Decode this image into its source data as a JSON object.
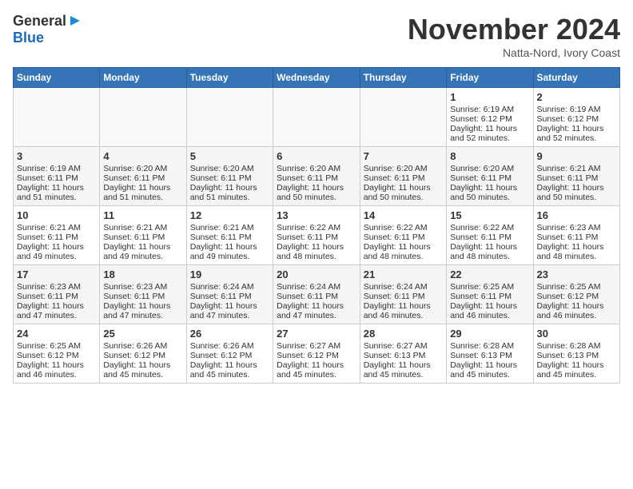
{
  "header": {
    "logo_general": "General",
    "logo_blue": "Blue",
    "month_title": "November 2024",
    "location": "Natta-Nord, Ivory Coast"
  },
  "days_of_week": [
    "Sunday",
    "Monday",
    "Tuesday",
    "Wednesday",
    "Thursday",
    "Friday",
    "Saturday"
  ],
  "weeks": [
    {
      "cells": [
        {
          "day": "",
          "sunrise": "",
          "sunset": "",
          "daylight": ""
        },
        {
          "day": "",
          "sunrise": "",
          "sunset": "",
          "daylight": ""
        },
        {
          "day": "",
          "sunrise": "",
          "sunset": "",
          "daylight": ""
        },
        {
          "day": "",
          "sunrise": "",
          "sunset": "",
          "daylight": ""
        },
        {
          "day": "",
          "sunrise": "",
          "sunset": "",
          "daylight": ""
        },
        {
          "day": "1",
          "sunrise": "Sunrise: 6:19 AM",
          "sunset": "Sunset: 6:12 PM",
          "daylight": "Daylight: 11 hours and 52 minutes."
        },
        {
          "day": "2",
          "sunrise": "Sunrise: 6:19 AM",
          "sunset": "Sunset: 6:12 PM",
          "daylight": "Daylight: 11 hours and 52 minutes."
        }
      ]
    },
    {
      "cells": [
        {
          "day": "3",
          "sunrise": "Sunrise: 6:19 AM",
          "sunset": "Sunset: 6:11 PM",
          "daylight": "Daylight: 11 hours and 51 minutes."
        },
        {
          "day": "4",
          "sunrise": "Sunrise: 6:20 AM",
          "sunset": "Sunset: 6:11 PM",
          "daylight": "Daylight: 11 hours and 51 minutes."
        },
        {
          "day": "5",
          "sunrise": "Sunrise: 6:20 AM",
          "sunset": "Sunset: 6:11 PM",
          "daylight": "Daylight: 11 hours and 51 minutes."
        },
        {
          "day": "6",
          "sunrise": "Sunrise: 6:20 AM",
          "sunset": "Sunset: 6:11 PM",
          "daylight": "Daylight: 11 hours and 50 minutes."
        },
        {
          "day": "7",
          "sunrise": "Sunrise: 6:20 AM",
          "sunset": "Sunset: 6:11 PM",
          "daylight": "Daylight: 11 hours and 50 minutes."
        },
        {
          "day": "8",
          "sunrise": "Sunrise: 6:20 AM",
          "sunset": "Sunset: 6:11 PM",
          "daylight": "Daylight: 11 hours and 50 minutes."
        },
        {
          "day": "9",
          "sunrise": "Sunrise: 6:21 AM",
          "sunset": "Sunset: 6:11 PM",
          "daylight": "Daylight: 11 hours and 50 minutes."
        }
      ]
    },
    {
      "cells": [
        {
          "day": "10",
          "sunrise": "Sunrise: 6:21 AM",
          "sunset": "Sunset: 6:11 PM",
          "daylight": "Daylight: 11 hours and 49 minutes."
        },
        {
          "day": "11",
          "sunrise": "Sunrise: 6:21 AM",
          "sunset": "Sunset: 6:11 PM",
          "daylight": "Daylight: 11 hours and 49 minutes."
        },
        {
          "day": "12",
          "sunrise": "Sunrise: 6:21 AM",
          "sunset": "Sunset: 6:11 PM",
          "daylight": "Daylight: 11 hours and 49 minutes."
        },
        {
          "day": "13",
          "sunrise": "Sunrise: 6:22 AM",
          "sunset": "Sunset: 6:11 PM",
          "daylight": "Daylight: 11 hours and 48 minutes."
        },
        {
          "day": "14",
          "sunrise": "Sunrise: 6:22 AM",
          "sunset": "Sunset: 6:11 PM",
          "daylight": "Daylight: 11 hours and 48 minutes."
        },
        {
          "day": "15",
          "sunrise": "Sunrise: 6:22 AM",
          "sunset": "Sunset: 6:11 PM",
          "daylight": "Daylight: 11 hours and 48 minutes."
        },
        {
          "day": "16",
          "sunrise": "Sunrise: 6:23 AM",
          "sunset": "Sunset: 6:11 PM",
          "daylight": "Daylight: 11 hours and 48 minutes."
        }
      ]
    },
    {
      "cells": [
        {
          "day": "17",
          "sunrise": "Sunrise: 6:23 AM",
          "sunset": "Sunset: 6:11 PM",
          "daylight": "Daylight: 11 hours and 47 minutes."
        },
        {
          "day": "18",
          "sunrise": "Sunrise: 6:23 AM",
          "sunset": "Sunset: 6:11 PM",
          "daylight": "Daylight: 11 hours and 47 minutes."
        },
        {
          "day": "19",
          "sunrise": "Sunrise: 6:24 AM",
          "sunset": "Sunset: 6:11 PM",
          "daylight": "Daylight: 11 hours and 47 minutes."
        },
        {
          "day": "20",
          "sunrise": "Sunrise: 6:24 AM",
          "sunset": "Sunset: 6:11 PM",
          "daylight": "Daylight: 11 hours and 47 minutes."
        },
        {
          "day": "21",
          "sunrise": "Sunrise: 6:24 AM",
          "sunset": "Sunset: 6:11 PM",
          "daylight": "Daylight: 11 hours and 46 minutes."
        },
        {
          "day": "22",
          "sunrise": "Sunrise: 6:25 AM",
          "sunset": "Sunset: 6:11 PM",
          "daylight": "Daylight: 11 hours and 46 minutes."
        },
        {
          "day": "23",
          "sunrise": "Sunrise: 6:25 AM",
          "sunset": "Sunset: 6:12 PM",
          "daylight": "Daylight: 11 hours and 46 minutes."
        }
      ]
    },
    {
      "cells": [
        {
          "day": "24",
          "sunrise": "Sunrise: 6:25 AM",
          "sunset": "Sunset: 6:12 PM",
          "daylight": "Daylight: 11 hours and 46 minutes."
        },
        {
          "day": "25",
          "sunrise": "Sunrise: 6:26 AM",
          "sunset": "Sunset: 6:12 PM",
          "daylight": "Daylight: 11 hours and 45 minutes."
        },
        {
          "day": "26",
          "sunrise": "Sunrise: 6:26 AM",
          "sunset": "Sunset: 6:12 PM",
          "daylight": "Daylight: 11 hours and 45 minutes."
        },
        {
          "day": "27",
          "sunrise": "Sunrise: 6:27 AM",
          "sunset": "Sunset: 6:12 PM",
          "daylight": "Daylight: 11 hours and 45 minutes."
        },
        {
          "day": "28",
          "sunrise": "Sunrise: 6:27 AM",
          "sunset": "Sunset: 6:13 PM",
          "daylight": "Daylight: 11 hours and 45 minutes."
        },
        {
          "day": "29",
          "sunrise": "Sunrise: 6:28 AM",
          "sunset": "Sunset: 6:13 PM",
          "daylight": "Daylight: 11 hours and 45 minutes."
        },
        {
          "day": "30",
          "sunrise": "Sunrise: 6:28 AM",
          "sunset": "Sunset: 6:13 PM",
          "daylight": "Daylight: 11 hours and 45 minutes."
        }
      ]
    }
  ]
}
